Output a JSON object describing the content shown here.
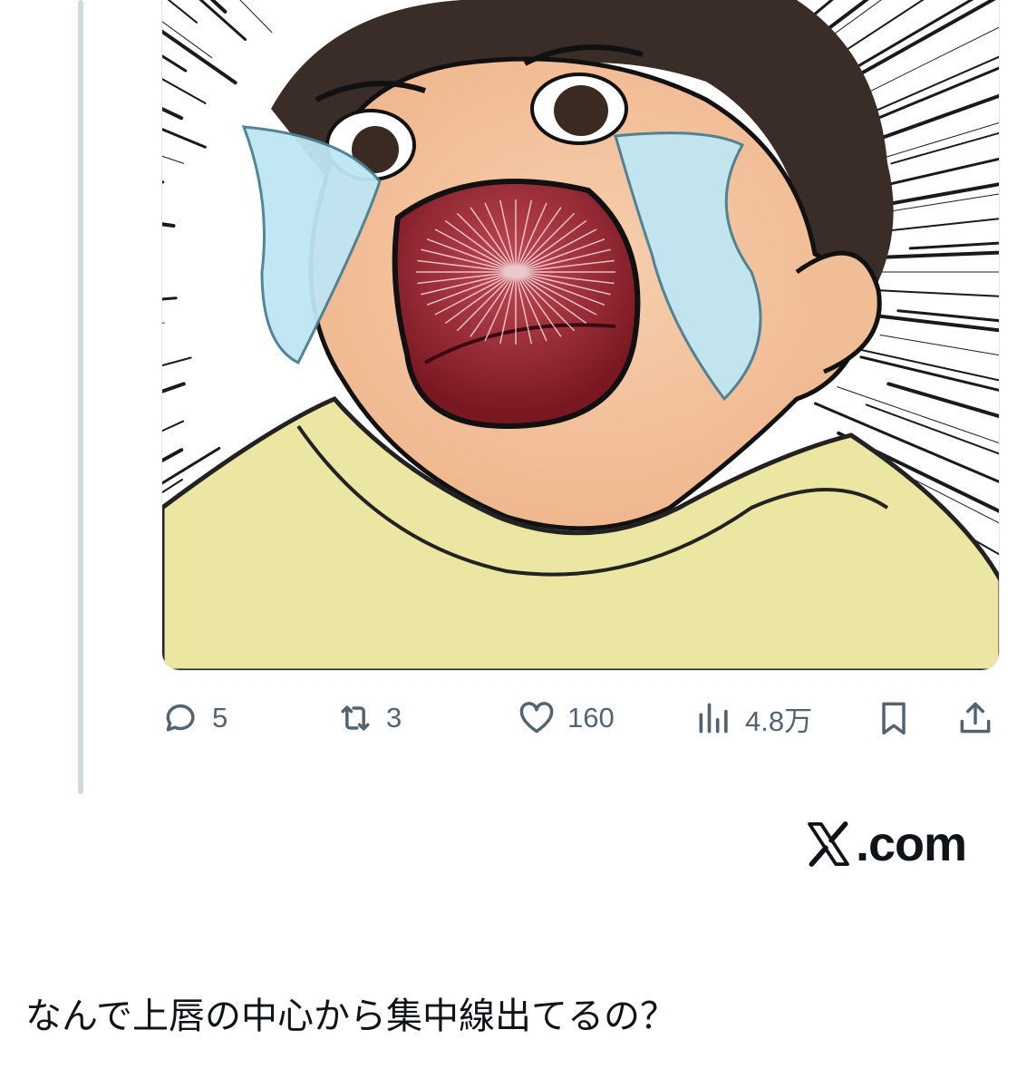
{
  "tweet": {
    "media": {
      "alt": "manga-style crying boy illustration with speed lines"
    },
    "actions": {
      "reply": {
        "icon": "reply-icon",
        "count": "5"
      },
      "retweet": {
        "icon": "retweet-icon",
        "count": "3"
      },
      "like": {
        "icon": "heart-icon",
        "count": "160"
      },
      "views": {
        "icon": "views-chart-icon",
        "count": "4.8万"
      },
      "bookmark": {
        "icon": "bookmark-icon"
      },
      "share": {
        "icon": "share-icon"
      }
    }
  },
  "watermark": {
    "text": ".com",
    "logo": "x-logo-icon"
  },
  "caption": {
    "text": "なんで上唇の中心から集中線出てるの？"
  },
  "colors": {
    "icon_gray": "#536471",
    "thread_line": "#cfd9de",
    "text": "#0f1419"
  }
}
